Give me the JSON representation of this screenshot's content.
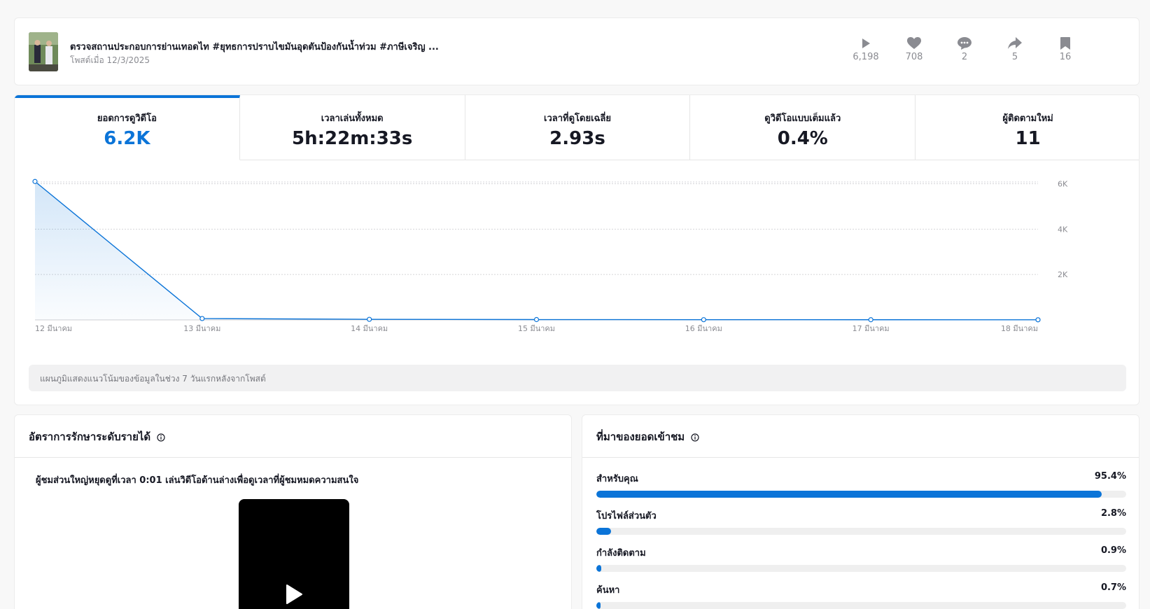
{
  "post": {
    "title": "ตรวจสถานประกอบการย่านเทอดไท #ยุทธการปราบไขมันอุดตันป้องกันน้ำท่วม #ภาษีเจริญ ...",
    "date": "โพสต์เมื่อ 12/3/2025",
    "stats": [
      {
        "icon": "play-icon",
        "value": "6,198"
      },
      {
        "icon": "heart-icon",
        "value": "708"
      },
      {
        "icon": "comment-icon",
        "value": "2"
      },
      {
        "icon": "share-icon",
        "value": "5"
      },
      {
        "icon": "bookmark-icon",
        "value": "16"
      }
    ]
  },
  "tabs": [
    {
      "label": "ยอดการดูวิดีโอ",
      "value": "6.2K",
      "active": true
    },
    {
      "label": "เวลาเล่นทั้งหมด",
      "value": "5h:22m:33s"
    },
    {
      "label": "เวลาที่ดูโดยเฉลี่ย",
      "value": "2.93s"
    },
    {
      "label": "ดูวิดีโอแบบเต็มแล้ว",
      "value": "0.4%"
    },
    {
      "label": "ผู้ติดตามใหม่",
      "value": "11"
    }
  ],
  "chart_data": {
    "type": "area",
    "x": [
      "12 มีนาคม",
      "13 มีนาคม",
      "14 มีนาคม",
      "15 มีนาคม",
      "16 มีนาคม",
      "17 มีนาคม",
      "18 มีนาคม"
    ],
    "values": [
      6100,
      60,
      25,
      15,
      10,
      8,
      5
    ],
    "yticks": [
      "2K",
      "4K",
      "6K"
    ],
    "ylim": [
      0,
      6200
    ],
    "grid": true,
    "color": "#0b74d8"
  },
  "chart_note": "แผนภูมิแสดงแนวโน้มของข้อมูลในช่วง 7 วันแรกหลังจากโพสต์",
  "retention": {
    "title": "อัตราการรักษาระดับรายได้",
    "description": "ผู้ชมส่วนใหญ่หยุดดูที่เวลา 0:01 เล่นวิดีโอด้านล่างเพื่อดูเวลาที่ผู้ชมหมดความสนใจ"
  },
  "sources": {
    "title": "ที่มาของยอดเข้าชม",
    "items": [
      {
        "label": "สำหรับคุณ",
        "value": "95.4%",
        "fraction": 0.954
      },
      {
        "label": "โปรไฟล์ส่วนตัว",
        "value": "2.8%",
        "fraction": 0.028
      },
      {
        "label": "กำลังติดตาม",
        "value": "0.9%",
        "fraction": 0.009
      },
      {
        "label": "ค้นหา",
        "value": "0.7%",
        "fraction": 0.007
      }
    ]
  },
  "colors": {
    "accent": "#0b74d8",
    "muted": "#8a8b91"
  }
}
